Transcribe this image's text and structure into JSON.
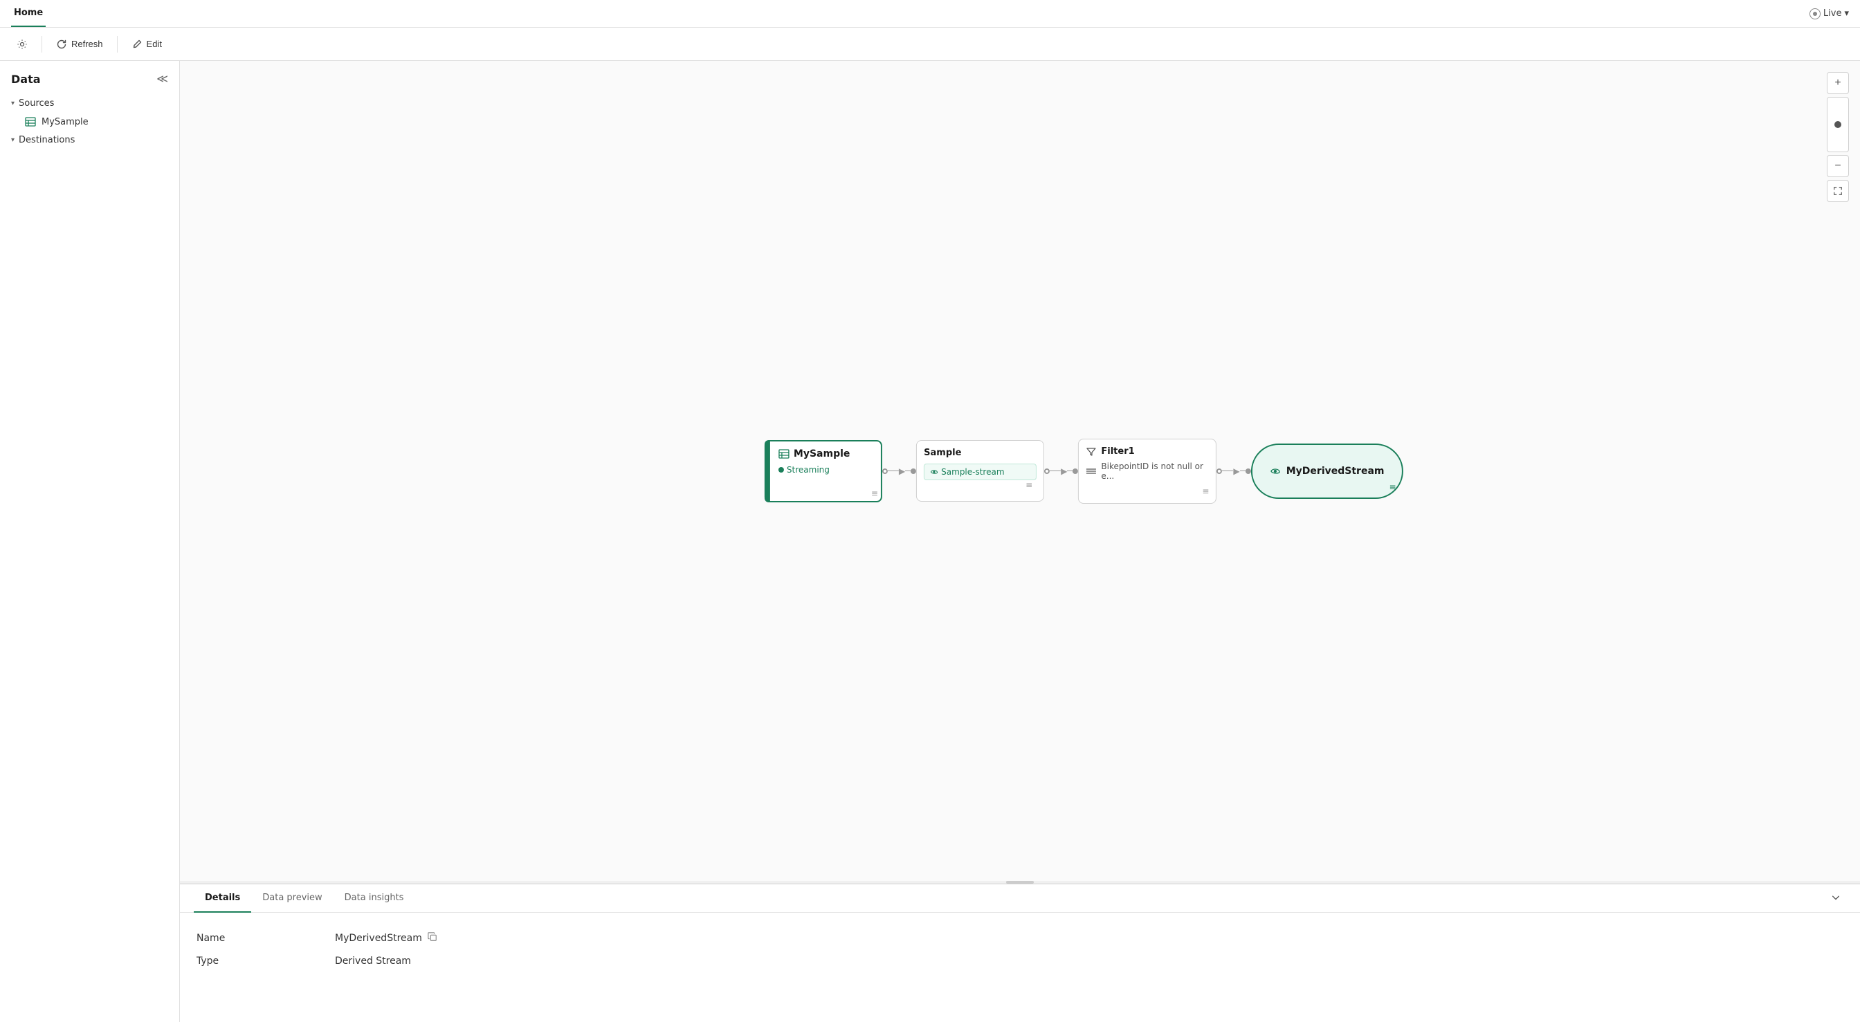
{
  "topnav": {
    "tab_label": "Home",
    "live_label": "Live",
    "live_icon": "eye-icon"
  },
  "toolbar": {
    "gear_icon": "gear-icon",
    "refresh_label": "Refresh",
    "refresh_icon": "refresh-icon",
    "edit_label": "Edit",
    "edit_icon": "edit-icon"
  },
  "sidebar": {
    "title": "Data",
    "collapse_icon": "collapse-icon",
    "sources_label": "Sources",
    "destinations_label": "Destinations",
    "sources_items": [
      {
        "name": "MySample",
        "icon": "table-icon"
      }
    ],
    "destinations_items": []
  },
  "canvas": {
    "nodes": [
      {
        "id": "source",
        "type": "source",
        "title": "MySample",
        "status": "Streaming",
        "icon": "table-icon"
      },
      {
        "id": "sample",
        "type": "sample",
        "title": "Sample",
        "stream_label": "Sample-stream",
        "icon": "stream-icon"
      },
      {
        "id": "filter",
        "type": "filter",
        "title": "Filter1",
        "condition": "BikepointID is not null or e...",
        "icon": "filter-icon"
      },
      {
        "id": "derived",
        "type": "derived",
        "title": "MyDerivedStream",
        "icon": "stream-icon"
      }
    ]
  },
  "zoom": {
    "plus_label": "+",
    "minus_label": "−",
    "fit_icon": "fit-icon"
  },
  "bottom_panel": {
    "tabs": [
      {
        "id": "details",
        "label": "Details",
        "active": true
      },
      {
        "id": "data-preview",
        "label": "Data preview",
        "active": false
      },
      {
        "id": "data-insights",
        "label": "Data insights",
        "active": false
      }
    ],
    "collapse_icon": "chevron-down-icon",
    "details": {
      "name_label": "Name",
      "name_value": "MyDerivedStream",
      "type_label": "Type",
      "type_value": "Derived Stream",
      "copy_icon": "copy-icon"
    }
  }
}
